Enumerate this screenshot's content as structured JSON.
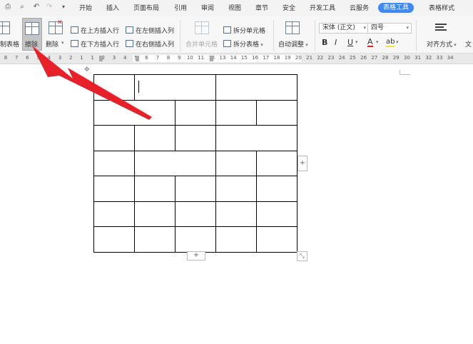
{
  "menu": {
    "tabs": [
      "开始",
      "插入",
      "页面布局",
      "引用",
      "审阅",
      "视图",
      "章节",
      "安全",
      "开发工具",
      "云服务",
      "表格工具",
      "表格样式"
    ],
    "active_tab": "表格工具"
  },
  "ribbon": {
    "draw_table": "制表格",
    "erase": "擦除",
    "delete": "删除",
    "insert_above": "在上方插入行",
    "insert_below": "在下方插入行",
    "insert_left": "在左侧插入列",
    "insert_right": "在右侧插入列",
    "merge_cells": "合并单元格",
    "split_cells": "拆分单元格",
    "split_table": "拆分表格",
    "auto_fit": "自动调整",
    "font_name": "宋体 (正文)",
    "font_size": "四号",
    "bold": "B",
    "italic": "I",
    "underline": "U",
    "font_color": "A",
    "highlight": "ab",
    "align": "对齐方式",
    "text_dir": "文"
  },
  "ruler": {
    "numbers": [
      "8",
      "7",
      "6",
      "5",
      "4",
      "3",
      "2",
      "1",
      "1",
      "2",
      "3",
      "4",
      "5",
      "6",
      "7",
      "8",
      "9",
      "10",
      "11",
      "12",
      "13",
      "14",
      "15",
      "16",
      "17",
      "18",
      "19",
      "20",
      "21",
      "22",
      "23",
      "24",
      "25",
      "26",
      "27",
      "28",
      "29",
      "30",
      "31",
      "32",
      "33",
      "34"
    ]
  },
  "table": {
    "rows": 7,
    "plus_label": "+"
  },
  "colors": {
    "accent": "#3e89f5",
    "arrow": "#e8202a"
  }
}
